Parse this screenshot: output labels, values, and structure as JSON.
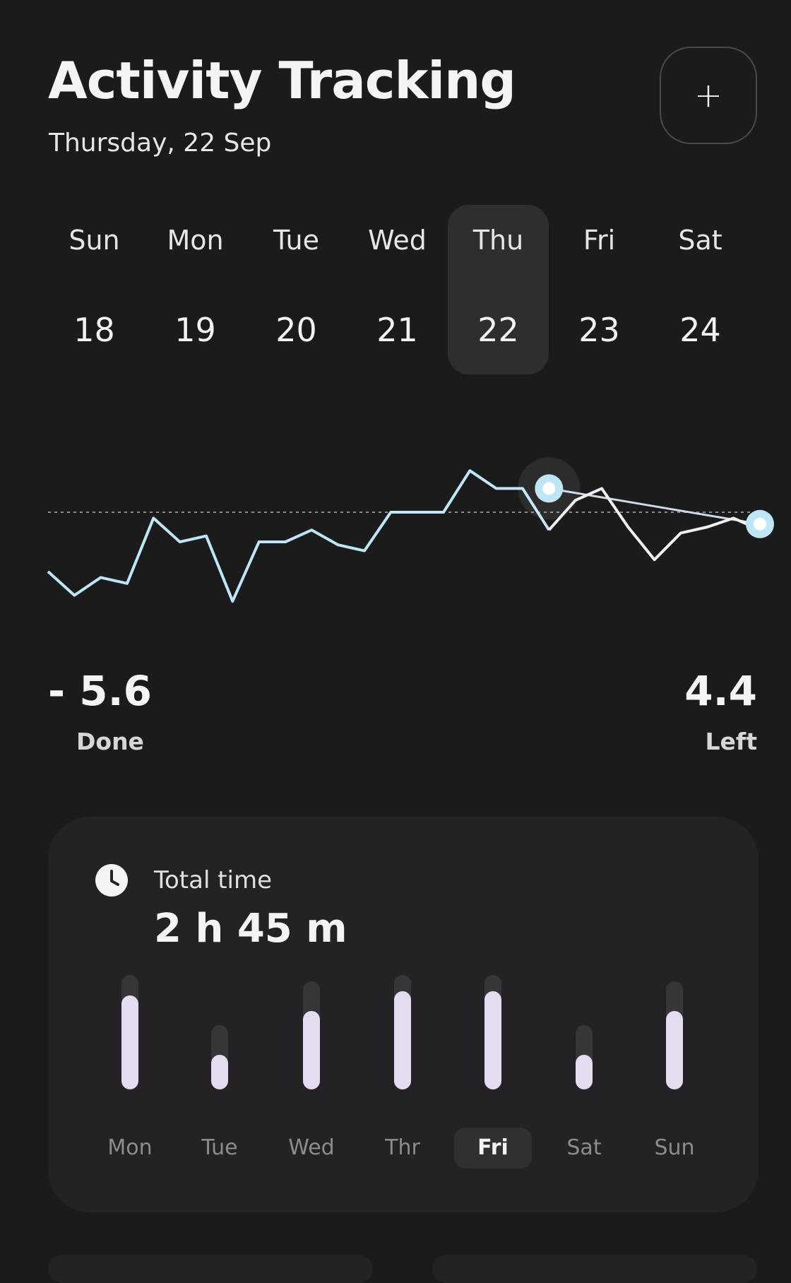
{
  "header": {
    "title": "Activity Tracking",
    "date": "Thursday, 22 Sep",
    "add_label": "+"
  },
  "week": {
    "selected_index": 4,
    "days": [
      {
        "name": "Sun",
        "num": "18"
      },
      {
        "name": "Mon",
        "num": "19"
      },
      {
        "name": "Tue",
        "num": "20"
      },
      {
        "name": "Wed",
        "num": "21"
      },
      {
        "name": "Thu",
        "num": "22"
      },
      {
        "name": "Fri",
        "num": "23"
      },
      {
        "name": "Sat",
        "num": "24"
      }
    ]
  },
  "chart_data": {
    "type": "line",
    "line_color": "#bfe6f7",
    "highlight_color": "#dff3fb",
    "grid": false,
    "reference_line": true,
    "series": [
      {
        "values": [
          -2.0,
          -2.8,
          -2.2,
          -2.4,
          -0.2,
          -1.0,
          -0.8,
          -3.0,
          -1.0,
          -1.0,
          -0.6,
          -1.1,
          -1.3,
          0.0,
          0.0,
          0.0,
          1.4,
          0.8,
          0.8,
          -0.6,
          0.4,
          0.8,
          -0.5,
          -1.6,
          -0.7,
          -0.5,
          -0.2,
          -0.6
        ]
      }
    ],
    "highlight_points": [
      {
        "index": 19,
        "value": 0.8
      },
      {
        "index": 27,
        "value": -0.4
      }
    ]
  },
  "stats": {
    "done_value": "- 5.6",
    "done_label": "Done",
    "left_value": "4.4",
    "left_label": "Left"
  },
  "total_time": {
    "label": "Total time",
    "value": "2 h 45 m",
    "icon": "clock-icon",
    "selected_index": 4,
    "bars": [
      {
        "day": "Mon",
        "value": 0.88
      },
      {
        "day": "Tue",
        "value": 0.28
      },
      {
        "day": "Wed",
        "value": 0.72
      },
      {
        "day": "Thr",
        "value": 0.92
      },
      {
        "day": "Fri",
        "value": 0.92
      },
      {
        "day": "Sat",
        "value": 0.28
      },
      {
        "day": "Sun",
        "value": 0.72
      }
    ]
  }
}
